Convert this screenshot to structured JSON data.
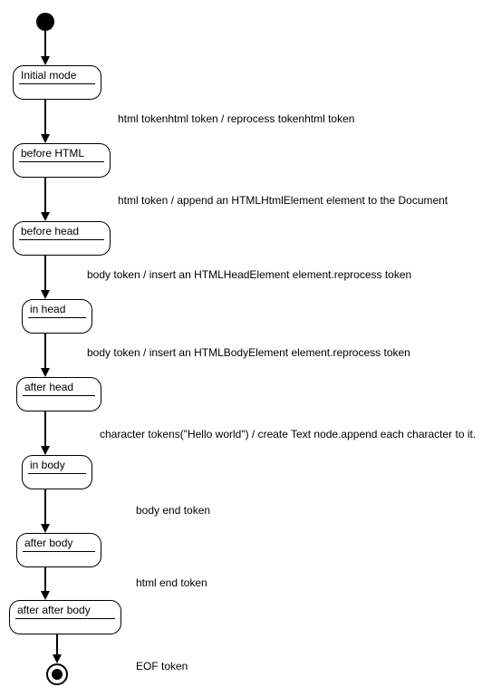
{
  "chart_data": {
    "type": "state-machine",
    "title": "",
    "states": [
      {
        "id": "start",
        "kind": "initial"
      },
      {
        "id": "initial-mode",
        "label": "Initial mode"
      },
      {
        "id": "before-html",
        "label": "before HTML"
      },
      {
        "id": "before-head",
        "label": "before head"
      },
      {
        "id": "in-head",
        "label": "in head"
      },
      {
        "id": "after-head",
        "label": "after head"
      },
      {
        "id": "in-body",
        "label": "in body"
      },
      {
        "id": "after-body",
        "label": "after body"
      },
      {
        "id": "after-after-body",
        "label": "after after body"
      },
      {
        "id": "end",
        "kind": "final"
      }
    ],
    "transitions": [
      {
        "from": "start",
        "to": "initial-mode",
        "label": ""
      },
      {
        "from": "initial-mode",
        "to": "before-html",
        "label": "html tokenhtml token / reprocess tokenhtml token"
      },
      {
        "from": "before-html",
        "to": "before-head",
        "label": "html token / append an HTMLHtmlElement element to the Document"
      },
      {
        "from": "before-head",
        "to": "in-head",
        "label": "body token / insert an HTMLHeadElement element.reprocess token"
      },
      {
        "from": "in-head",
        "to": "after-head",
        "label": "body token / insert an HTMLBodyElement element.reprocess token"
      },
      {
        "from": "after-head",
        "to": "in-body",
        "label": "character tokens(\"Hello world\") / create Text node.append each character to it."
      },
      {
        "from": "in-body",
        "to": "after-body",
        "label": "body end token"
      },
      {
        "from": "after-body",
        "to": "after-after-body",
        "label": "html end token"
      },
      {
        "from": "after-after-body",
        "to": "end",
        "label": "EOF token"
      }
    ]
  },
  "states": {
    "initial_mode": "Initial mode",
    "before_html": "before HTML",
    "before_head": "before head",
    "in_head": "in head",
    "after_head": "after head",
    "in_body": "in body",
    "after_body": "after body",
    "after_after_body": "after after body"
  },
  "edges": {
    "e1": "html tokenhtml token / reprocess tokenhtml token",
    "e2": "html token / append an HTMLHtmlElement element to the Document",
    "e3": "body token / insert an HTMLHeadElement element.reprocess token",
    "e4": "body token / insert an HTMLBodyElement element.reprocess token",
    "e5": "character tokens(\"Hello world\") / create Text node.append each character to it.",
    "e6": "body end token",
    "e7": "html end token",
    "e8": "EOF token"
  }
}
